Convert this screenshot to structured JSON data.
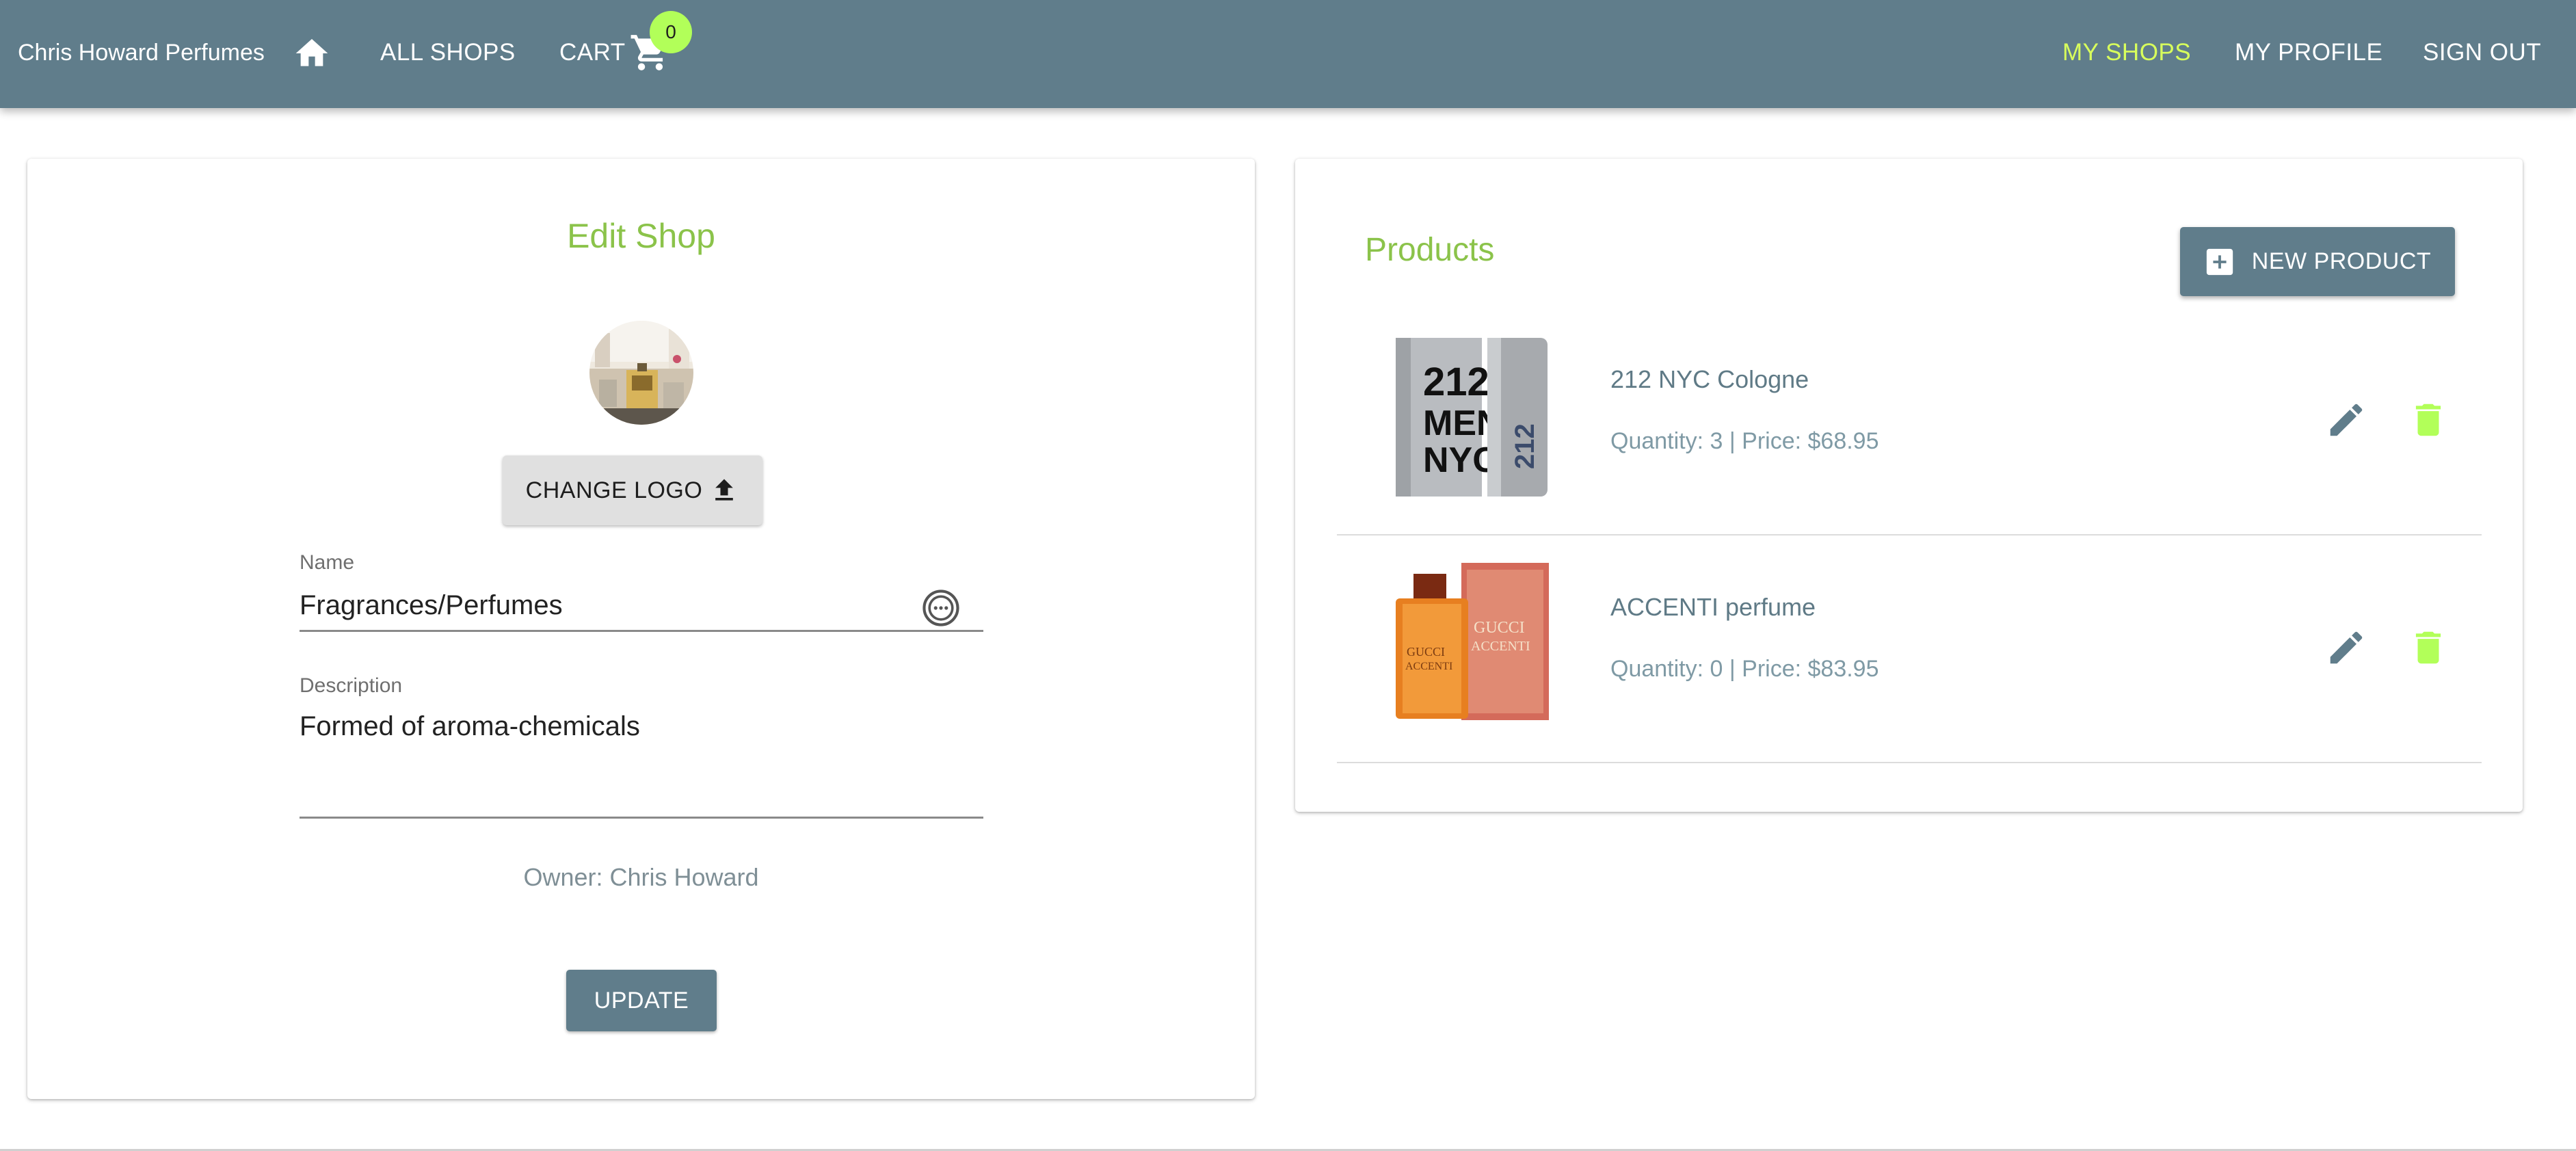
{
  "appbar": {
    "brand": "Chris Howard Perfumes",
    "home_icon": "home-icon",
    "all_shops_label": "ALL SHOPS",
    "cart_label": "CART",
    "cart_count": "0",
    "my_shops_label": "MY SHOPS",
    "my_profile_label": "MY PROFILE",
    "sign_out_label": "SIGN OUT",
    "active_item": "MY SHOPS"
  },
  "edit_shop": {
    "title": "Edit Shop",
    "change_logo_label": "CHANGE LOGO",
    "name_label": "Name",
    "name_value": "Fragrances/Perfumes",
    "description_label": "Description",
    "description_value": "Formed of aroma-chemicals",
    "owner_text": "Owner: Chris Howard",
    "update_label": "UPDATE"
  },
  "products": {
    "title": "Products",
    "new_product_label": "NEW PRODUCT",
    "items": [
      {
        "name": "212 NYC Cologne",
        "meta": "Quantity: 3 | Price: $68.95"
      },
      {
        "name": "ACCENTI perfume",
        "meta": "Quantity: 0 | Price: $83.95"
      }
    ]
  },
  "colors": {
    "appbar": "#607d8b",
    "accent_green": "#8bc34a",
    "active_nav": "#d8ff5c",
    "badge": "#b2ff59",
    "delete_icon": "#b2ff59"
  }
}
